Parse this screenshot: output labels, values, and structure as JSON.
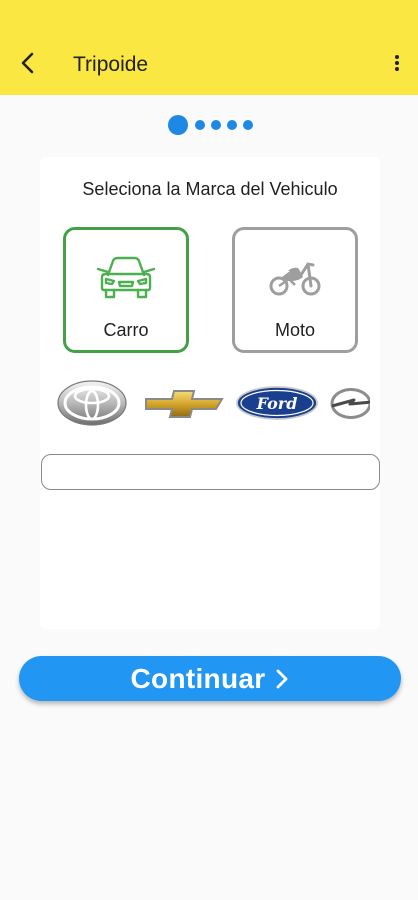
{
  "appbar": {
    "title": "Tripoide",
    "back_icon": "arrow-back-icon",
    "menu_icon": "more-vertical-icon",
    "background": "#fae741"
  },
  "stepper": {
    "total_steps": 5,
    "current_step": 1,
    "color": "#1e88e5"
  },
  "form": {
    "title": "Seleciona la Marca del Vehiculo",
    "vehicle_types": [
      {
        "label": "Carro",
        "icon": "car-icon",
        "selected": true,
        "border_color": "#43a047"
      },
      {
        "label": "Moto",
        "icon": "motorcycle-icon",
        "selected": false,
        "border_color": "#9e9e9e"
      }
    ],
    "brand_logos": [
      "toyota-logo",
      "chevrolet-logo",
      "ford-logo",
      "opel-logo"
    ],
    "ford_logo_text": "Ford",
    "brand_input": {
      "value": "",
      "placeholder": ""
    }
  },
  "continue_button": {
    "label": "Continuar",
    "icon": "chevron-right-icon",
    "color": "#2196f3"
  }
}
